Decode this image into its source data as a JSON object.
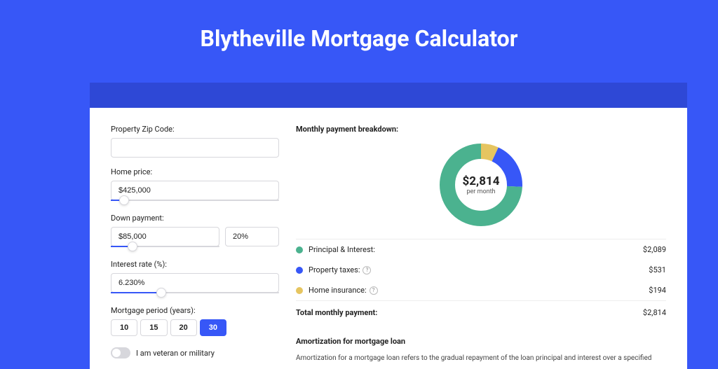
{
  "title": "Blytheville Mortgage Calculator",
  "form": {
    "zip": {
      "label": "Property Zip Code:",
      "value": ""
    },
    "home_price": {
      "label": "Home price:",
      "value": "$425,000",
      "slider_pct": 8
    },
    "down_payment": {
      "label": "Down payment:",
      "amount": "$85,000",
      "pct": "20%",
      "slider_pct": 20
    },
    "interest_rate": {
      "label": "Interest rate (%):",
      "value": "6.230%",
      "slider_pct": 30
    },
    "mortgage_period": {
      "label": "Mortgage period (years):",
      "options": [
        "10",
        "15",
        "20",
        "30"
      ],
      "selected": "30"
    },
    "veteran_label": "I am veteran or military"
  },
  "breakdown": {
    "title": "Monthly payment breakdown:",
    "center_value": "$2,814",
    "center_sub": "per month",
    "rows": [
      {
        "label": "Principal & Interest:",
        "value": "$2,089"
      },
      {
        "label": "Property taxes:",
        "value": "$531"
      },
      {
        "label": "Home insurance:",
        "value": "$194"
      }
    ],
    "total_label": "Total monthly payment:",
    "total_value": "$2,814"
  },
  "chart_data": {
    "type": "pie",
    "title": "Monthly payment breakdown",
    "series": [
      {
        "name": "Principal & Interest",
        "value": 2089,
        "color": "#4bb28f"
      },
      {
        "name": "Property taxes",
        "value": 531,
        "color": "#3757f7"
      },
      {
        "name": "Home insurance",
        "value": 194,
        "color": "#e6c560"
      }
    ],
    "total": 2814
  },
  "amortization": {
    "title": "Amortization for mortgage loan",
    "text": "Amortization for a mortgage loan refers to the gradual repayment of the loan principal and interest over a specified"
  }
}
